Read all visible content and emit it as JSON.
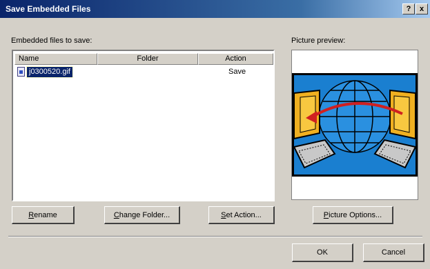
{
  "window": {
    "title": "Save Embedded Files",
    "help_button": "?",
    "close_button": "x"
  },
  "files_section": {
    "label": "Embedded files to save:",
    "columns": [
      "Name",
      "Folder",
      "Action"
    ],
    "rows": [
      {
        "name": "j0300520.gif",
        "folder": "",
        "action": "Save"
      }
    ]
  },
  "preview_section": {
    "label": "Picture preview:",
    "image_description_icon": "network-computers-globe-icon"
  },
  "buttons": {
    "rename": {
      "accel": "R",
      "rest": "ename"
    },
    "change_folder": {
      "accel": "C",
      "rest": "hange Folder..."
    },
    "set_action": {
      "accel": "S",
      "rest": "et Action..."
    },
    "picture_options": {
      "accel": "P",
      "rest": "icture Options..."
    },
    "ok": "OK",
    "cancel": "Cancel"
  },
  "colors": {
    "title_bar": "#0a246a",
    "dialog_bg": "#d4d0c8",
    "selection": "#0a246a"
  }
}
